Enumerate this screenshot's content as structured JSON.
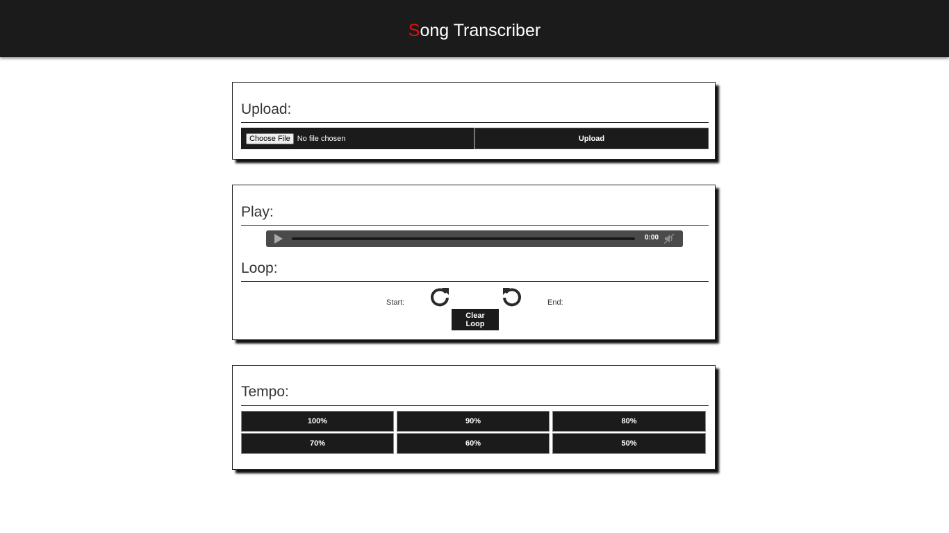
{
  "header": {
    "title_first_letter": "S",
    "title_rest": "ong Transcriber",
    "accent_color": "#e01010"
  },
  "upload": {
    "heading": "Upload:",
    "choose_file_label": "Choose File",
    "file_status": "No file chosen",
    "upload_label": "Upload"
  },
  "play": {
    "heading": "Play:",
    "audio": {
      "time": "0:00",
      "icons": [
        "play-icon",
        "mute-icon"
      ]
    }
  },
  "loop": {
    "heading": "Loop:",
    "start_label": "Start:",
    "end_label": "End:",
    "clear_label": "Clear Loop",
    "icons": [
      "redo-icon",
      "undo-icon"
    ]
  },
  "tempo": {
    "heading": "Tempo:",
    "options": [
      "100%",
      "90%",
      "80%",
      "70%",
      "60%",
      "50%"
    ]
  },
  "colors": {
    "dark": "#1b1b1b",
    "accent": "#e01010"
  }
}
